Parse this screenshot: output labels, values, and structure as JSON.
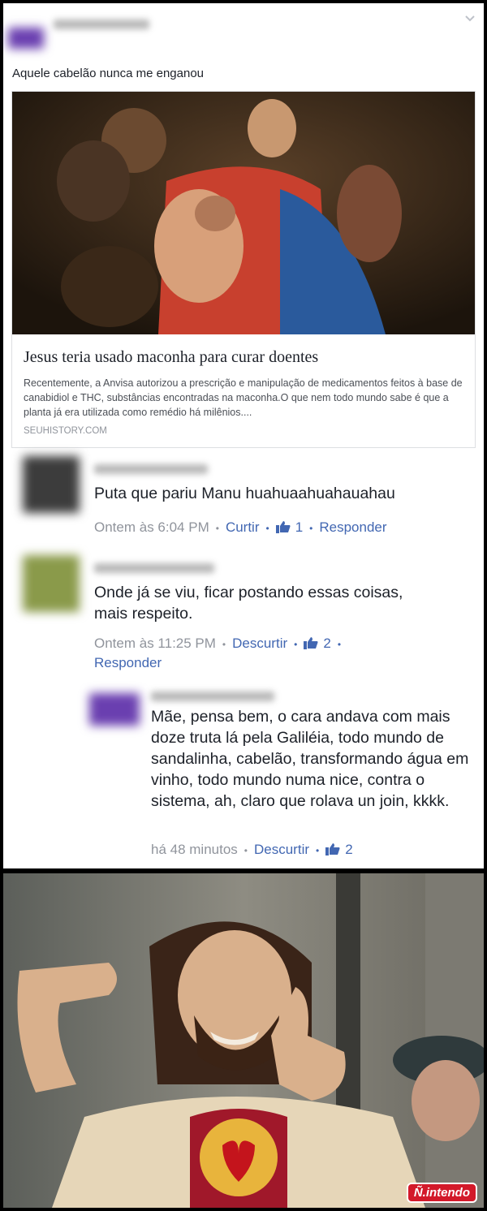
{
  "post": {
    "caption": "Aquele cabelão nunca me enganou",
    "chevron_icon": "chevron-down-icon"
  },
  "link_card": {
    "title": "Jesus teria usado maconha para curar doentes",
    "description": "Recentemente, a Anvisa autorizou a prescrição e manipulação de medicamentos feitos à base de canabidiol e THC, substâncias encontradas na maconha.O que nem todo mundo sabe é que a planta já era utilizada como remédio há milênios....",
    "domain": "SEUHISTORY.COM"
  },
  "comments": [
    {
      "text": "Puta que pariu Manu huahuaahuahauahau",
      "time": "Ontem às 6:04 PM",
      "like_action": "Curtir",
      "like_count": "1",
      "reply_action": "Responder"
    },
    {
      "text": "Onde já se viu, ficar postando essas coisas, mais respeito.",
      "time": "Ontem às 11:25 PM",
      "like_action": "Descurtir",
      "like_count": "2",
      "reply_action": "Responder"
    },
    {
      "text": "Mãe, pensa bem, o cara andava com mais doze truta lá pela Galiléia,  todo mundo de sandalinha, cabelão, transformando água em vinho, todo mundo numa nice, contra o sistema, ah, claro que rolava un join, kkkk.",
      "time": "há 48 minutos",
      "like_action": "Descurtir",
      "like_count": "2"
    }
  ],
  "watermark": {
    "text": "Ñ.intendo",
    "color": "#d3192a"
  },
  "colors": {
    "link": "#4267b2",
    "meta": "#90949c",
    "text": "#1d2129"
  }
}
